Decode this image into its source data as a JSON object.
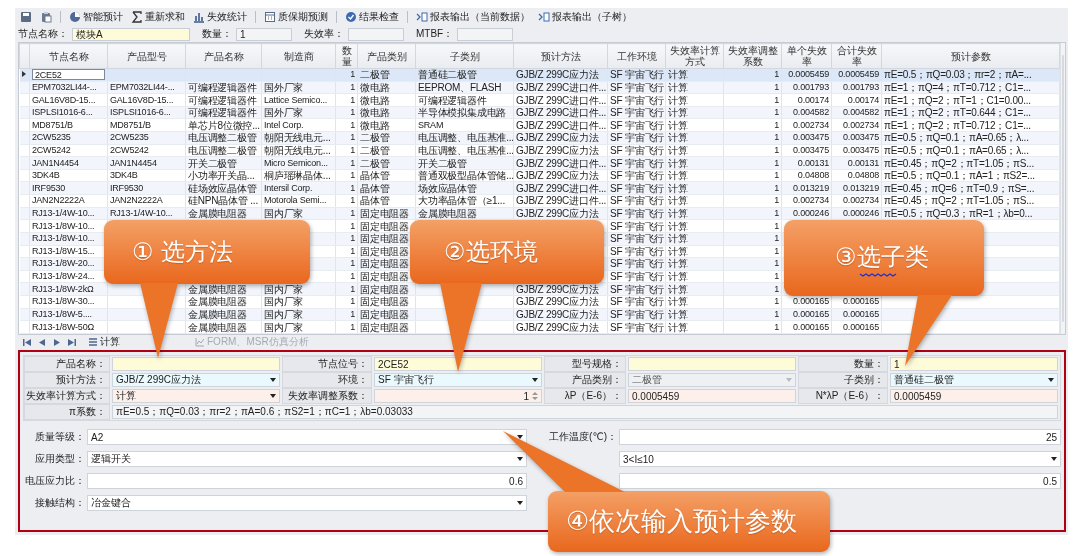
{
  "toolbar": [
    {
      "kind": "save"
    },
    {
      "kind": "paste"
    },
    {
      "kind": "pie",
      "label": "智能预计"
    },
    {
      "kind": "sum",
      "label": "重新求和"
    },
    {
      "kind": "bars",
      "label": "失效统计"
    },
    {
      "kind": "calendar",
      "label": "质保期预测"
    },
    {
      "kind": "check",
      "label": "结果检查"
    },
    {
      "kind": "export",
      "label": "报表输出（当前数据）"
    },
    {
      "kind": "export",
      "label": "报表输出（子树）"
    }
  ],
  "summary": [
    {
      "label": "节点名称：",
      "value": "模块A",
      "editable": true
    },
    {
      "label": "数量：",
      "value": "1",
      "editable": false
    },
    {
      "label": "失效率：",
      "editable": false
    },
    {
      "label": "MTBF：",
      "editable": false
    }
  ],
  "table": {
    "columns": [
      "节点名称",
      "产品型号",
      "产品名称",
      "制造商",
      "数量",
      "产品类别",
      "子类别",
      "预计方法",
      "工作环境",
      "失效率计算方式",
      "失效率调整系数",
      "单个失效率",
      "合计失效率",
      "预计参数"
    ],
    "rows": [
      {
        "selected": true,
        "cells": [
          "2CE52",
          null,
          null,
          null,
          "1",
          "二极管",
          "普通硅二极管",
          "GJB/Z 299C应力法",
          "SF 宇宙飞行",
          "计算",
          "1",
          "0.0005459",
          "0.0005459",
          "πE=0.5；πQ=0.03；πr=2；πA=..."
        ]
      },
      {
        "selected": false,
        "cells": [
          "EPM7032LI44-...",
          "EPM7032LI44-...",
          "可编程逻辑器件",
          "国外厂家",
          "1",
          "微电路",
          "EEPROM、FLASH",
          "GJB/Z 299C进口件...",
          "SF 宇宙飞行",
          "计算",
          "1",
          "0.001793",
          "0.001793",
          "πE=1；πQ=4；πT=0.712；C1=..."
        ]
      },
      {
        "selected": false,
        "cells": [
          "GAL16V8D-15...",
          "GAL16V8D-15...",
          "可编程逻辑器件",
          "Lattice Semico...",
          "1",
          "微电路",
          "可编程逻辑器件",
          "GJB/Z 299C进口件...",
          "SF 宇宙飞行",
          "计算",
          "1",
          "0.00174",
          "0.00174",
          "πE=1；πQ=2；πT=1；C1=0.00..."
        ]
      },
      {
        "selected": false,
        "cells": [
          "ISPLSI1016-6...",
          "ISPLSI1016-6...",
          "可编程逻辑器件",
          "国外厂家",
          "1",
          "微电路",
          "半导体模拟集成电路",
          "GJB/Z 299C进口件...",
          "SF 宇宙飞行",
          "计算",
          "1",
          "0.004582",
          "0.004582",
          "πE=1；πQ=2；πT=0.644；C1=..."
        ]
      },
      {
        "selected": false,
        "cells": [
          "MD8751/B",
          "MD8751/B",
          "单芯片8位微控...",
          "Intel Corp.",
          "1",
          "微电路",
          "SRAM",
          "GJB/Z 299C进口件...",
          "SF 宇宙飞行",
          "计算",
          "1",
          "0.002734",
          "0.002734",
          "πE=1；πQ=2；πT=0.712；C1=..."
        ]
      },
      {
        "selected": false,
        "cells": [
          "2CW5235",
          "2CW5235",
          "电压调整二极管",
          "朝阳无线电元...",
          "1",
          "二极管",
          "电压调整、电压基准...",
          "GJB/Z 299C应力法",
          "SF 宇宙飞行",
          "计算",
          "1",
          "0.003475",
          "0.003475",
          "πE=0.5；πQ=0.1；πA=0.65；λ..."
        ]
      },
      {
        "selected": false,
        "cells": [
          "2CW5242",
          "2CW5242",
          "电压调整二极管",
          "朝阳无线电元...",
          "1",
          "二极管",
          "电压调整、电压基准...",
          "GJB/Z 299C应力法",
          "SF 宇宙飞行",
          "计算",
          "1",
          "0.003475",
          "0.003475",
          "πE=0.5；πQ=0.1；πA=0.65；λ..."
        ]
      },
      {
        "selected": false,
        "cells": [
          "JAN1N4454",
          "JAN1N4454",
          "开关二极管",
          "Micro Semicon...",
          "1",
          "二极管",
          "开关二极管",
          "GJB/Z 299C进口件...",
          "SF 宇宙飞行",
          "计算",
          "1",
          "0.00131",
          "0.00131",
          "πE=0.45；πQ=2；πT=1.05；πS..."
        ]
      },
      {
        "selected": false,
        "cells": [
          "3DK4B",
          "3DK4B",
          "小功率开关晶...",
          "桐庐瑶琳晶体...",
          "1",
          "晶体管",
          "普通双极型晶体管储...",
          "GJB/Z 299C应力法",
          "SF 宇宙飞行",
          "计算",
          "1",
          "0.04808",
          "0.04808",
          "πE=0.5；πQ=0.1；πA=1；πS2=..."
        ]
      },
      {
        "selected": false,
        "cells": [
          "IRF9530",
          "IRF9530",
          "硅场效应晶体管",
          "Intersil Corp.",
          "1",
          "晶体管",
          "场效应晶体管",
          "GJB/Z 299C进口件...",
          "SF 宇宙飞行",
          "计算",
          "1",
          "0.013219",
          "0.013219",
          "πE=0.45；πQ=6；πT=0.9；πS=..."
        ]
      },
      {
        "selected": false,
        "cells": [
          "JAN2N2222A",
          "JAN2N2222A",
          "硅NPN晶体管 ...",
          "Motorola Semi...",
          "1",
          "晶体管",
          "大功率晶体管（≥1...",
          "GJB/Z 299C进口件...",
          "SF 宇宙飞行",
          "计算",
          "1",
          "0.002734",
          "0.002734",
          "πE=0.45；πQ=2；πT=1.05；πS..."
        ]
      },
      {
        "selected": false,
        "cells": [
          "RJ13-1/4W-10...",
          "RJ13-1/4W-10...",
          "金属膜电阻器",
          "国内厂家",
          "1",
          "固定电阻器",
          "金属膜电阻器",
          "GJB/Z 299C应力法",
          "SF 宇宙飞行",
          "计算",
          "1",
          "0.000246",
          "0.000246",
          "πE=0.5；πQ=0.3；πR=1；λb=0..."
        ]
      },
      {
        "selected": false,
        "cells": [
          "RJ13-1/8W-10...",
          null,
          null,
          null,
          "1",
          "固定电阻器",
          null,
          null,
          "SF 宇宙飞行",
          "计算",
          "1",
          null,
          null,
          null
        ]
      },
      {
        "selected": false,
        "cells": [
          "RJ13-1/8W-10...",
          null,
          null,
          null,
          "1",
          "固定电阻器",
          null,
          null,
          "SF 宇宙飞行",
          "计算",
          "1",
          null,
          null,
          null
        ]
      },
      {
        "selected": false,
        "cells": [
          "RJ13-1/8W-15...",
          null,
          null,
          null,
          "1",
          "固定电阻器",
          null,
          null,
          "SF 宇宙飞行",
          "计算",
          "1",
          null,
          null,
          null
        ]
      },
      {
        "selected": false,
        "cells": [
          "RJ13-1/8W-20...",
          null,
          null,
          null,
          "1",
          "固定电阻器",
          null,
          null,
          "SF 宇宙飞行",
          "计算",
          "1",
          null,
          null,
          null
        ]
      },
      {
        "selected": false,
        "cells": [
          "RJ13-1/8W-24...",
          null,
          null,
          null,
          "1",
          "固定电阻器",
          null,
          null,
          "SF 宇宙飞行",
          "计算",
          "1",
          null,
          null,
          null
        ]
      },
      {
        "selected": false,
        "cells": [
          "RJ13-1/8W-2kΩ",
          null,
          "金属膜电阻器",
          "国内厂家",
          "1",
          "固定电阻器",
          null,
          "GJB/Z 299C应力法",
          "SF 宇宙飞行",
          "计算",
          "1",
          null,
          null,
          null
        ]
      },
      {
        "selected": false,
        "cells": [
          "RJ13-1/8W-30...",
          null,
          "金属膜电阻器",
          "国内厂家",
          "1",
          "固定电阻器",
          null,
          "GJB/Z 299C应力法",
          "SF 宇宙飞行",
          "计算",
          "1",
          "0.000165",
          "0.000165",
          null
        ]
      },
      {
        "selected": false,
        "cells": [
          "RJ13-1/8W-5....",
          null,
          "金属膜电阻器",
          "国内厂家",
          "1",
          "固定电阻器",
          null,
          "GJB/Z 299C应力法",
          "SF 宇宙飞行",
          "计算",
          "1",
          "0.000165",
          "0.000165",
          null
        ]
      },
      {
        "selected": false,
        "cells": [
          "RJ13-1/8W-50Ω",
          null,
          "金属膜电阻器",
          "国内厂家",
          "1",
          "固定电阻器",
          null,
          "GJB/Z 299C应力法",
          "SF 宇宙飞行",
          "计算",
          "1",
          "0.000165",
          "0.000165",
          null
        ]
      }
    ]
  },
  "pager": [
    {
      "kind": "first"
    },
    {
      "kind": "prev"
    },
    {
      "kind": "next"
    },
    {
      "kind": "last"
    },
    {
      "kind": "calc",
      "label": "计算",
      "disabled": false
    },
    {
      "kind": "chart",
      "label": "FORM、MSR仿真分析",
      "disabled": true
    }
  ],
  "form": {
    "grid": [
      [
        {
          "label": "产品名称：",
          "kind": "text",
          "disabled": false
        },
        {
          "label": "节点位号：",
          "kind": "text",
          "value": "2CE52",
          "disabled": false
        },
        {
          "label": "型号规格：",
          "kind": "text",
          "disabled": false
        },
        {
          "label": "数量：",
          "kind": "text",
          "value": "1",
          "disabled": false
        }
      ],
      [
        {
          "label": "预计方法：",
          "kind": "select",
          "value": "GJB/Z 299C应力法",
          "disabled": false
        },
        {
          "label": "环境：",
          "kind": "select",
          "value": "SF 宇宙飞行",
          "disabled": false
        },
        {
          "label": "产品类别：",
          "kind": "select",
          "value": "二极管",
          "disabled": true
        },
        {
          "label": "子类别：",
          "kind": "select",
          "value": "普通硅二极管",
          "disabled": false
        }
      ],
      [
        {
          "label": "失效率计算方式：",
          "kind": "calc-select",
          "value": "计算",
          "disabled": false
        },
        {
          "label": "失效率调整系数：",
          "kind": "spin",
          "value": "1",
          "disabled": false
        },
        {
          "label": "λP（E-6）：",
          "kind": "calc",
          "value": "0.0005459",
          "disabled": false
        },
        {
          "label": "N*λP（E-6）：",
          "kind": "calc",
          "value": "0.0005459",
          "disabled": false
        }
      ],
      [
        {
          "label": "π系数：",
          "kind": "wide",
          "value": "πE=0.5；πQ=0.03；πr=2；πA=0.6；πS2=1；πC=1；λb=0.03033",
          "disabled": false
        }
      ]
    ],
    "params_left": [
      {
        "label": "质量等级：",
        "kind": "select",
        "value": "A2"
      },
      {
        "label": "应用类型：",
        "kind": "select",
        "value": "逻辑开关"
      },
      {
        "label": "电压应力比：",
        "kind": "number",
        "value": "0.6"
      },
      {
        "label": "接触结构：",
        "kind": "select",
        "value": "冶金键合"
      }
    ],
    "params_right": [
      {
        "label": "工作温度(℃)：",
        "kind": "number",
        "value": "25"
      },
      {
        "kind": "select",
        "value": "3<I≤10"
      },
      {
        "kind": "number",
        "value": "0.5"
      }
    ]
  },
  "callouts": [
    {
      "text": "①  选方法",
      "flagged": false
    },
    {
      "text": "②选环境",
      "flagged": false
    },
    {
      "text": "③选子类",
      "flagged": true
    },
    {
      "text": "④依次输入预计参数",
      "flagged": false
    }
  ]
}
